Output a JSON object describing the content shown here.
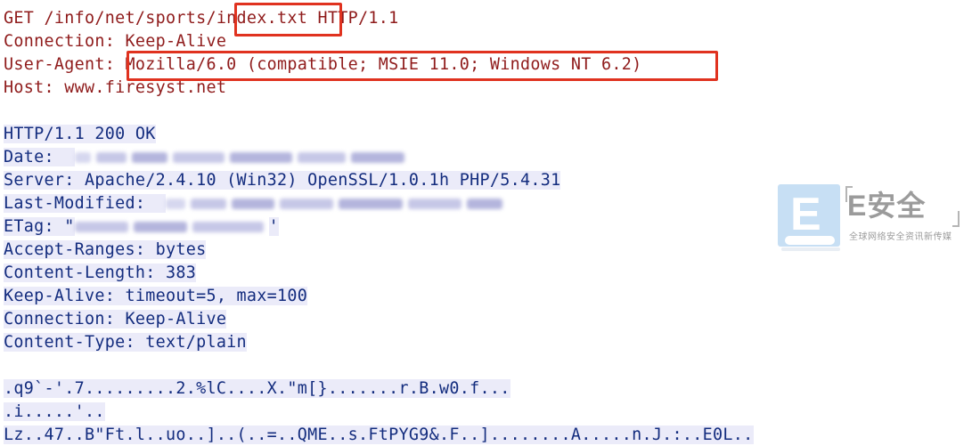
{
  "request": {
    "line1": "GET /info/net/sports/index.txt HTTP/1.1",
    "line2": "Connection: Keep-Alive",
    "line3": "User-Agent: Mozilla/6.0 (compatible; MSIE 11.0; Windows NT 6.2)",
    "line4": "Host: www.firesyst.net"
  },
  "response": {
    "status": "HTTP/1.1 200 OK",
    "date_label": "Date:",
    "server": "Server: Apache/2.4.10 (Win32) OpenSSL/1.0.1h PHP/5.4.31",
    "last_modified_label": "Last-Modified:",
    "etag_label": "ETag: \"",
    "etag_close": "'",
    "accept_ranges": "Accept-Ranges: bytes",
    "content_length": "Content-Length: 383",
    "keep_alive": "Keep-Alive: timeout=5, max=100",
    "connection": "Connection: Keep-Alive",
    "content_type": "Content-Type: text/plain"
  },
  "body": {
    "line1": ".q9`-'.7.........2.%lC....X.\"m[}.......r.B.w0.f...",
    "line2": ".i.....'..",
    "line3": "Lz..47..B\"Ft.l..uo..]..(..=..QME..s.FtPYG9&.F..]........A.....n.J.:..E0L.."
  },
  "watermark": {
    "logo_letter": "E",
    "title": "E安全",
    "subtitle": "全球网络安全资讯新传媒"
  },
  "colors": {
    "request_text": "#8f1b1b",
    "response_text": "#132c7e",
    "response_bg": "#ebebf9",
    "highlight_box": "#e0321f"
  }
}
